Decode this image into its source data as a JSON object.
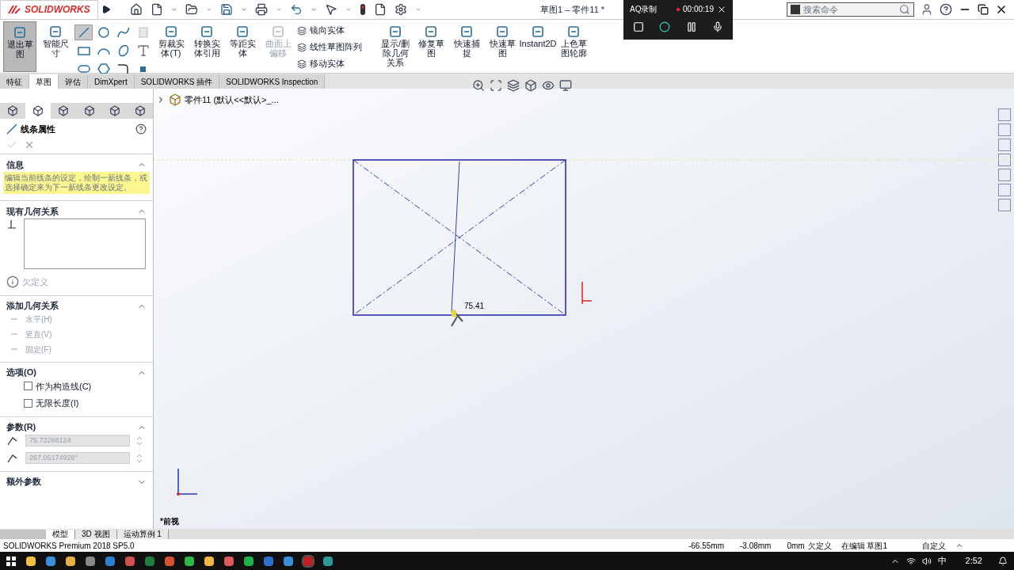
{
  "title_bar": {
    "logo": "SOLIDWORKS",
    "title": "草图1 – 零件11 *",
    "search_placeholder": "搜索命令"
  },
  "recorder": {
    "name": "AQ录制",
    "time": "00:00:19"
  },
  "ribbon": [
    {
      "kind": "large",
      "label": "退出草图",
      "selected": true,
      "disabled": false
    },
    {
      "kind": "large",
      "label": "智能尺寸",
      "selected": false,
      "disabled": false
    },
    {
      "kind": "tools",
      "tools": [
        {
          "kind": "line",
          "selected": true
        },
        {
          "kind": "circle",
          "selected": false
        },
        {
          "kind": "spline",
          "selected": false
        },
        {
          "kind": "plane",
          "selected": false
        },
        {
          "kind": "rectangle",
          "selected": false
        },
        {
          "kind": "arc",
          "selected": false
        },
        {
          "kind": "ellipse",
          "selected": false
        },
        {
          "kind": "text",
          "selected": false
        },
        {
          "kind": "slot",
          "selected": false
        },
        {
          "kind": "polygon",
          "selected": false
        },
        {
          "kind": "fillet",
          "selected": false
        },
        {
          "kind": "point",
          "selected": false
        }
      ]
    },
    {
      "kind": "large",
      "label": "剪裁实体(T)",
      "selected": false,
      "disabled": false
    },
    {
      "kind": "large",
      "label": "转换实体引用",
      "selected": false,
      "disabled": false
    },
    {
      "kind": "large",
      "label": "等距实体",
      "selected": false,
      "disabled": false
    },
    {
      "kind": "large",
      "label": "曲面上偏移",
      "selected": false,
      "disabled": true
    },
    {
      "kind": "stack",
      "entries": [
        "镜向实体",
        "线性草图阵列",
        "移动实体"
      ]
    },
    {
      "kind": "large",
      "label": "显示/删除几何关系",
      "selected": false,
      "disabled": false
    },
    {
      "kind": "large",
      "label": "修复草图",
      "selected": false,
      "disabled": false
    },
    {
      "kind": "large",
      "label": "快速捕捉",
      "selected": false,
      "disabled": false
    },
    {
      "kind": "large",
      "label": "快速草图",
      "selected": false,
      "disabled": false
    },
    {
      "kind": "large",
      "label": "Instant2D",
      "selected": false,
      "disabled": false
    },
    {
      "kind": "large",
      "label": "上色草图轮廓",
      "selected": false,
      "disabled": false
    }
  ],
  "tabs": [
    {
      "label": "特征",
      "selected": false
    },
    {
      "label": "草图",
      "selected": true
    },
    {
      "label": "评估",
      "selected": false
    },
    {
      "label": "DimXpert",
      "selected": false
    },
    {
      "label": "SOLIDWORKS 插件",
      "selected": false
    },
    {
      "label": "SOLIDWORKS Inspection",
      "selected": false
    }
  ],
  "panel": {
    "title": "线条属性",
    "sections": [
      {
        "kind": "info",
        "title": "信息",
        "expanded": true,
        "message": "编辑当前线条的设定，绘制一新线条，或选择确定来为下一新线条更改设定。"
      },
      {
        "kind": "relations",
        "title": "现有几何关系",
        "expanded": true,
        "status": "欠定义"
      },
      {
        "kind": "add",
        "title": "添加几何关系",
        "expanded": true,
        "items": [
          {
            "label": "水平(H)",
            "disabled": true
          },
          {
            "label": "竖直(V)",
            "disabled": true
          },
          {
            "label": "固定(F)",
            "disabled": true
          }
        ]
      },
      {
        "kind": "options",
        "title": "选项(O)",
        "expanded": true,
        "items": [
          {
            "label": "作为构造线(C)",
            "checked": false
          },
          {
            "label": "无限长度(I)",
            "checked": false
          }
        ]
      },
      {
        "kind": "params",
        "title": "参数(R)",
        "expanded": true,
        "values": [
          "75.73288124",
          "267.05174928°"
        ]
      },
      {
        "kind": "extra",
        "title": "额外参数",
        "expanded": false
      }
    ]
  },
  "canvas": {
    "tree_label": "零件11  (默认<<默认>_...",
    "dimension": "75.41",
    "view_label": "*前视"
  },
  "bottom_tabs": [
    {
      "label": "模型",
      "selected": true
    },
    {
      "label": "3D 视图",
      "selected": false
    },
    {
      "label": "运动算例 1",
      "selected": false
    }
  ],
  "status_bar": {
    "product": "SOLIDWORKS Premium 2018 SP5.0",
    "x": "-66.55mm",
    "y": "-3.08mm",
    "z": "0mm",
    "state": "欠定义",
    "editing": "在编辑 草图1",
    "units": "自定义"
  },
  "taskbar": {
    "ime": "中",
    "time": "2:52"
  }
}
